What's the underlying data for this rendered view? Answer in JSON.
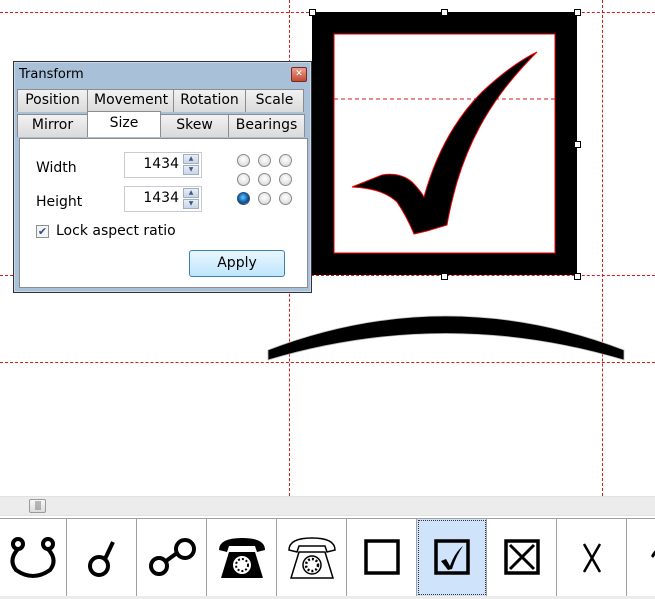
{
  "dialog": {
    "title": "Transform",
    "close_icon": "close-icon",
    "tabs_row1": [
      "Position",
      "Movement",
      "Rotation",
      "Scale"
    ],
    "tabs_row2": [
      "Mirror",
      "Size",
      "Skew",
      "Bearings"
    ],
    "active_tab": "Size",
    "width_label": "Width",
    "width_value": "1434",
    "height_label": "Height",
    "height_value": "1434",
    "origin_selected": "bottom-left",
    "lock_label": "Lock aspect ratio",
    "lock_checked": true,
    "apply_label": "Apply"
  },
  "canvas": {
    "current_glyph": "checkbox-checked",
    "guide_color": "#d71a1a"
  },
  "glyph_strip": {
    "items": [
      {
        "name": "horseshoe-loops-glyph"
      },
      {
        "name": "circle-with-stem-glyph"
      },
      {
        "name": "two-circles-linked-glyph"
      },
      {
        "name": "telephone-black-glyph"
      },
      {
        "name": "telephone-outline-glyph"
      },
      {
        "name": "ballot-box-glyph"
      },
      {
        "name": "ballot-box-check-glyph",
        "selected": true
      },
      {
        "name": "ballot-box-x-glyph"
      },
      {
        "name": "ballot-x-glyph"
      },
      {
        "name": "partial-glyph"
      }
    ],
    "selected_color": "#cfe3fb"
  }
}
